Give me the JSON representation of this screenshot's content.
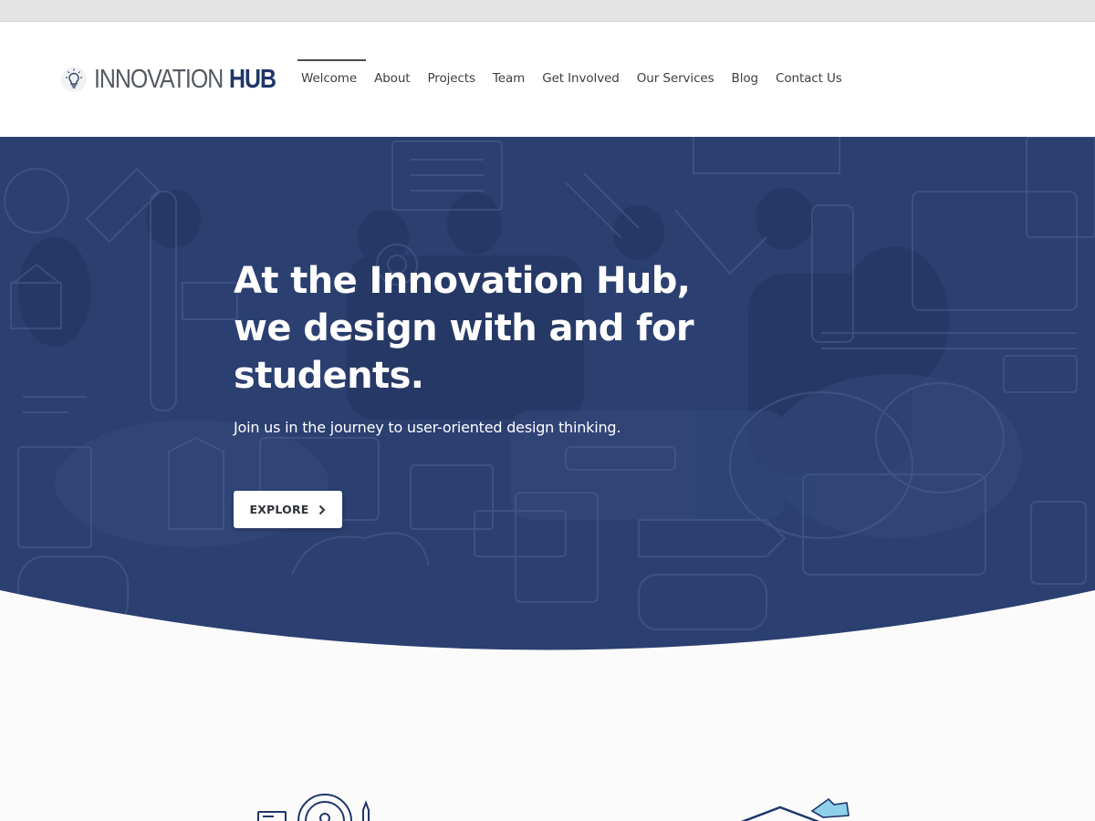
{
  "brand": {
    "logo_icon": "lightbulb-icon",
    "name_part1": "INNOVATION",
    "name_part2": "HUB",
    "colors": {
      "primary": "#1f3768",
      "gray": "#555a60"
    }
  },
  "nav": {
    "items": [
      {
        "label": "Welcome",
        "active": true
      },
      {
        "label": "About"
      },
      {
        "label": "Projects"
      },
      {
        "label": "Team"
      },
      {
        "label": "Get Involved"
      },
      {
        "label": "Our Services"
      },
      {
        "label": "Blog"
      },
      {
        "label": "Contact Us"
      }
    ]
  },
  "hero": {
    "title": "At the Innovation Hub, we design with and for students.",
    "subtitle": "Join us in the journey to user-oriented design thinking.",
    "cta_label": "EXPLORE",
    "cta_icon": "chevron-right-icon",
    "overlay_color": "#2b3f70"
  }
}
